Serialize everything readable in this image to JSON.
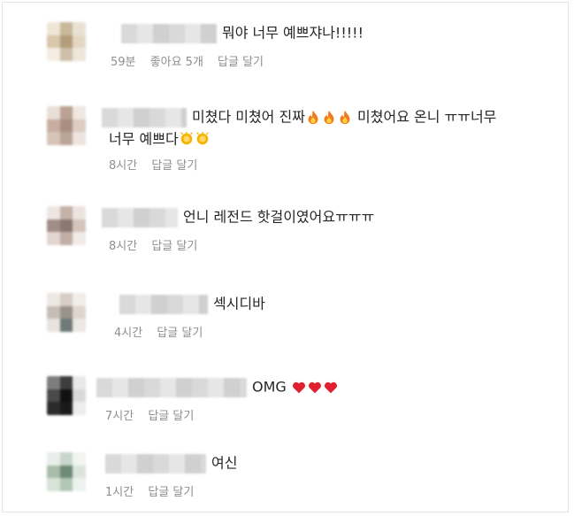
{
  "comments": [
    {
      "text": "뭐야 너무 예쁘쟈나!!!!!",
      "text2": "",
      "emoji": [],
      "emoji2": [],
      "time": "59분",
      "likes": "좋아요 5개",
      "reply": "답글 달기"
    },
    {
      "text": "미쳤다 미쳤어 진짜",
      "text_after": "미쳤어요 온니 ㅠㅠ너무",
      "text2": "너무 예쁘다",
      "emoji": [
        "fire-icon",
        "fire-icon",
        "fire-icon"
      ],
      "emoji2": [
        "clap-icon",
        "clap-icon"
      ],
      "time": "8시간",
      "likes": "",
      "reply": "답글 달기"
    },
    {
      "text": "언니 레전드 핫걸이였어요ㅠㅠㅠ",
      "text2": "",
      "emoji": [],
      "emoji2": [],
      "time": "8시간",
      "likes": "",
      "reply": "답글 달기"
    },
    {
      "text": "섹시디바",
      "text2": "",
      "emoji": [],
      "emoji2": [],
      "time": "4시간",
      "likes": "",
      "reply": "답글 달기"
    },
    {
      "text": "OMG",
      "text2": "",
      "emoji": [
        "heart-icon",
        "heart-icon",
        "heart-icon"
      ],
      "emoji2": [],
      "time": "7시간",
      "likes": "",
      "reply": "답글 달기"
    },
    {
      "text": "여신",
      "text2": "",
      "emoji": [],
      "emoji2": [],
      "time": "1시간",
      "likes": "",
      "reply": "답글 달기"
    }
  ],
  "colors": {
    "text": "#262626",
    "meta": "#8e8e8e",
    "heart": "#e0202e",
    "fire": "#f27a1a",
    "clap": "#f4b400"
  }
}
